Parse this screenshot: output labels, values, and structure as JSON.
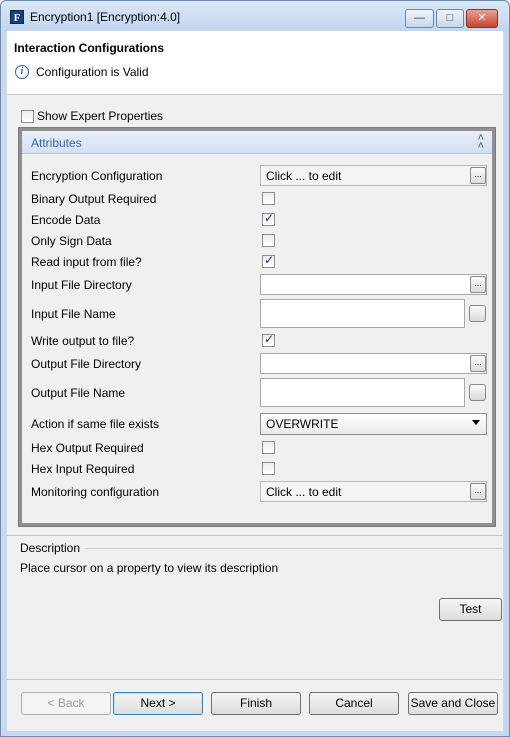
{
  "window": {
    "title": "Encryption1 [Encryption:4.0]",
    "app_icon_letter": "F",
    "controls": {
      "minimize": "—",
      "maximize": "□",
      "close": "✕"
    }
  },
  "header": {
    "title": "Interaction Configurations",
    "status": "Configuration is Valid",
    "status_icon": "info-icon"
  },
  "expert": {
    "label": "Show Expert Properties",
    "checked": false
  },
  "attributes": {
    "section_title": "Attributes",
    "collapse_glyph": "˄\n˄",
    "props": {
      "encryption_configuration": {
        "label": "Encryption Configuration",
        "value": "Click ... to edit",
        "button": "..."
      },
      "binary_output_required": {
        "label": "Binary Output Required",
        "checked": false
      },
      "encode_data": {
        "label": "Encode Data",
        "checked": true
      },
      "only_sign_data": {
        "label": "Only Sign Data",
        "checked": false
      },
      "read_input_from_file": {
        "label": "Read input from file?",
        "checked": true
      },
      "input_file_directory": {
        "label": "Input File Directory",
        "value": "",
        "button": "..."
      },
      "input_file_name": {
        "label": "Input File Name",
        "value": ""
      },
      "write_output_to_file": {
        "label": "Write output to file?",
        "checked": true
      },
      "output_file_directory": {
        "label": "Output File Directory",
        "value": "",
        "button": "..."
      },
      "output_file_name": {
        "label": "Output File Name",
        "value": ""
      },
      "action_if_same_file_exists": {
        "label": "Action if same file exists",
        "value": "OVERWRITE"
      },
      "hex_output_required": {
        "label": "Hex Output Required",
        "checked": false
      },
      "hex_input_required": {
        "label": "Hex Input Required",
        "checked": false
      },
      "monitoring_configuration": {
        "label": "Monitoring configuration",
        "value": "Click ... to edit",
        "button": "..."
      }
    }
  },
  "description": {
    "title": "Description",
    "text": "Place cursor on a property to view its description"
  },
  "buttons": {
    "test": "Test",
    "back": "< Back",
    "next": "Next >",
    "finish": "Finish",
    "cancel": "Cancel",
    "save_and_close": "Save and Close"
  },
  "colors": {
    "title_bar": "#c2d6ee",
    "section_header_text": "#3a66b0",
    "close_button": "#c7432b"
  }
}
